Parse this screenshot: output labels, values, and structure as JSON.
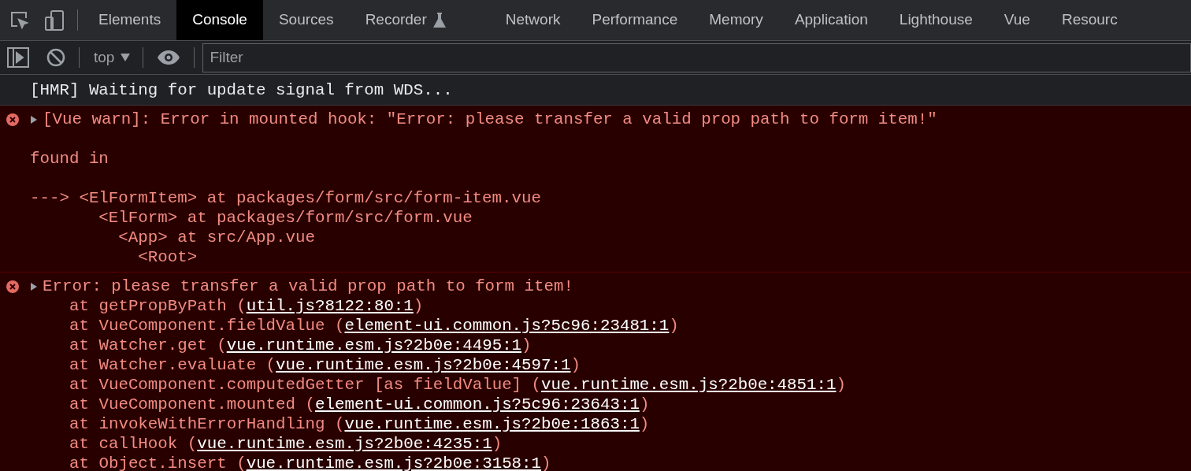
{
  "tabs": [
    {
      "label": "Elements",
      "selected": false,
      "kind": "plain"
    },
    {
      "label": "Console",
      "selected": true,
      "kind": "plain"
    },
    {
      "label": "Sources",
      "selected": false,
      "kind": "plain"
    },
    {
      "label": "Recorder",
      "selected": false,
      "kind": "experimental"
    },
    {
      "label": "Network",
      "selected": false,
      "kind": "plain"
    },
    {
      "label": "Performance",
      "selected": false,
      "kind": "plain"
    },
    {
      "label": "Memory",
      "selected": false,
      "kind": "plain"
    },
    {
      "label": "Application",
      "selected": false,
      "kind": "plain"
    },
    {
      "label": "Lighthouse",
      "selected": false,
      "kind": "plain"
    },
    {
      "label": "Vue",
      "selected": false,
      "kind": "plain"
    },
    {
      "label": "Resourc",
      "selected": false,
      "kind": "plain"
    }
  ],
  "toolbar": {
    "context": "top",
    "filter": {
      "placeholder": "Filter"
    }
  },
  "messages": [
    {
      "kind": "info",
      "text": "[HMR] Waiting for update signal from WDS..."
    },
    {
      "kind": "error",
      "expanded": false,
      "text": "[Vue warn]: Error in mounted hook: \"Error: please transfer a valid prop path to form item!\"",
      "blocks": [
        [
          "found in"
        ],
        [
          "---> <ElFormItem> at packages/form/src/form-item.vue",
          "       <ElForm> at packages/form/src/form.vue",
          "         <App> at src/App.vue",
          "           <Root>"
        ]
      ]
    },
    {
      "kind": "error",
      "expanded": false,
      "text": "Error: please transfer a valid prop path to form item!",
      "frames": [
        {
          "prefix": "at getPropByPath (",
          "link": "util.js?8122:80:1",
          "suffix": ")"
        },
        {
          "prefix": "at VueComponent.fieldValue (",
          "link": "element-ui.common.js?5c96:23481:1",
          "suffix": ")"
        },
        {
          "prefix": "at Watcher.get (",
          "link": "vue.runtime.esm.js?2b0e:4495:1",
          "suffix": ")"
        },
        {
          "prefix": "at Watcher.evaluate (",
          "link": "vue.runtime.esm.js?2b0e:4597:1",
          "suffix": ")"
        },
        {
          "prefix": "at VueComponent.computedGetter [as fieldValue] (",
          "link": "vue.runtime.esm.js?2b0e:4851:1",
          "suffix": ")"
        },
        {
          "prefix": "at VueComponent.mounted (",
          "link": "element-ui.common.js?5c96:23643:1",
          "suffix": ")"
        },
        {
          "prefix": "at invokeWithErrorHandling (",
          "link": "vue.runtime.esm.js?2b0e:1863:1",
          "suffix": ")"
        },
        {
          "prefix": "at callHook (",
          "link": "vue.runtime.esm.js?2b0e:4235:1",
          "suffix": ")"
        },
        {
          "prefix": "at Object.insert (",
          "link": "vue.runtime.esm.js?2b0e:3158:1",
          "suffix": ")"
        }
      ]
    }
  ]
}
